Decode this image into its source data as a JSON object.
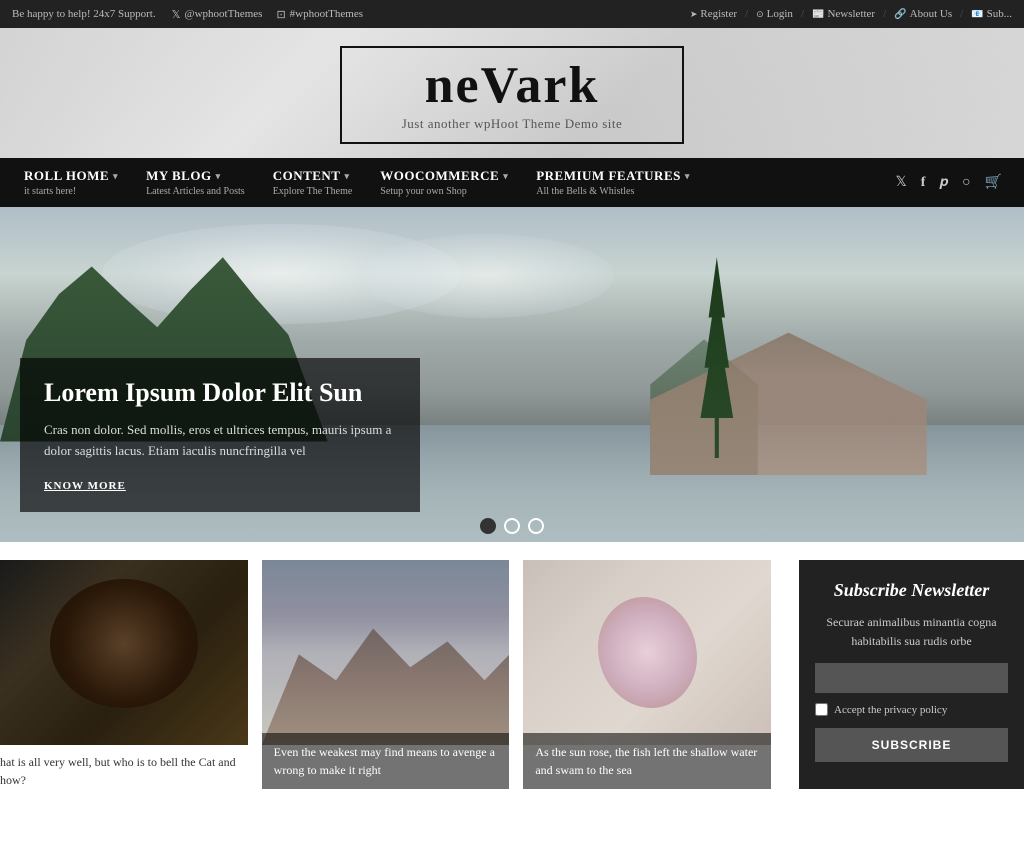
{
  "topbar": {
    "support_text": "Be happy to help! 24x7 Support.",
    "twitter_label": "@wphootThemes",
    "instagram_label": "#wphootThemes",
    "register_label": "Register",
    "login_label": "Login",
    "newsletter_label": "Newsletter",
    "about_label": "About Us",
    "subscribe_label": "Sub..."
  },
  "site": {
    "title_start": "ne",
    "title_bold": "Vark",
    "tagline": "Just another wpHoot Theme Demo site"
  },
  "nav": {
    "items": [
      {
        "title": "ROLL HOME",
        "subtitle": "it starts here!",
        "has_arrow": true
      },
      {
        "title": "MY BLOG",
        "subtitle": "Latest Articles and Posts",
        "has_arrow": true
      },
      {
        "title": "CONTENT",
        "subtitle": "Explore The Theme",
        "has_arrow": true
      },
      {
        "title": "WOOCOMMERCE",
        "subtitle": "Setup your own Shop",
        "has_arrow": true
      },
      {
        "title": "PREMIUM FEATURES",
        "subtitle": "All the Bells & Whistles",
        "has_arrow": true
      }
    ]
  },
  "hero": {
    "title": "Lorem Ipsum Dolor Elit Sun",
    "description": "Cras non dolor. Sed mollis, eros et ultrices tempus, mauris ipsum a dolor sagittis lacus. Etiam iaculis nuncfringilla vel",
    "cta_label": "KNOW MORE",
    "dots": [
      {
        "active": true
      },
      {
        "active": false
      },
      {
        "active": false
      }
    ]
  },
  "articles": [
    {
      "caption": "hat is all very well, but who is to bell the Cat and how?"
    },
    {
      "caption": "Even the weakest may find means to avenge a wrong to make it right"
    },
    {
      "caption": "As the sun rose, the fish left the shallow water and swam to the sea"
    }
  ],
  "newsletter": {
    "title": "Subscribe Newsletter",
    "description": "Securae animalibus minantia cogna habitabilis sua rudis orbe",
    "email_placeholder": "",
    "privacy_label": "Accept the privacy policy",
    "submit_label": "SUBSCRIBE"
  }
}
